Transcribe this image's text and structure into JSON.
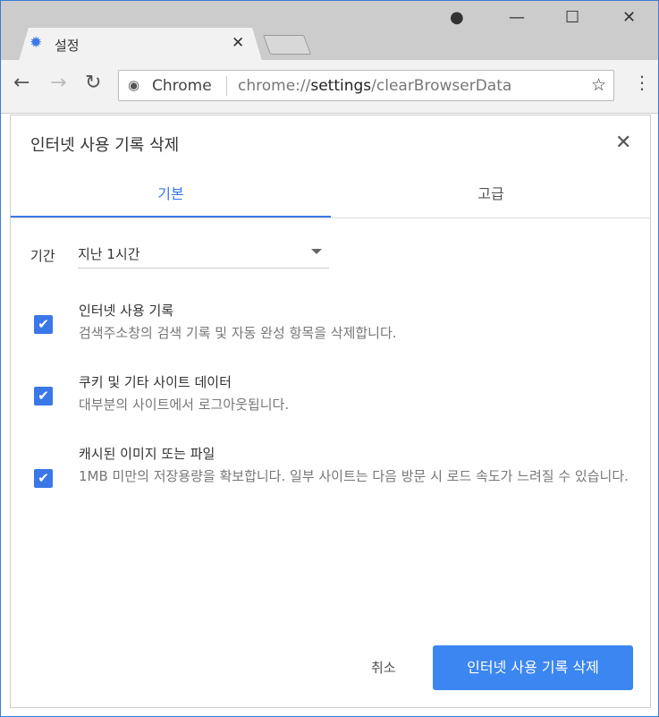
{
  "browser": {
    "tab_title": "설정",
    "tab_icon": "gear-icon",
    "omnibox_label": "Chrome",
    "url_prefix": "chrome://",
    "url_host": "settings",
    "url_path": "/clearBrowserData"
  },
  "dialog": {
    "title": "인터넷 사용 기록 삭제",
    "tabs": [
      {
        "label": "기본",
        "active": true
      },
      {
        "label": "고급",
        "active": false
      }
    ],
    "period_label": "기간",
    "period_value": "지난 1시간",
    "items": [
      {
        "title": "인터넷 사용 기록",
        "desc": "검색주소창의 검색 기록 및 자동 완성 항목을 삭제합니다.",
        "checked": true
      },
      {
        "title": "쿠키 및 기타 사이트 데이터",
        "desc": "대부분의 사이트에서 로그아웃됩니다.",
        "checked": true
      },
      {
        "title": "캐시된 이미지 또는 파일",
        "desc": "1MB 미만의 저장용량을 확보합니다. 일부 사이트는 다음 방문 시 로드 속도가 느려질 수 있습니다.",
        "checked": true
      }
    ],
    "cancel_label": "취소",
    "confirm_label": "인터넷 사용 기록 삭제"
  },
  "colors": {
    "accent": "#3b78e7",
    "button": "#3b86f0"
  }
}
